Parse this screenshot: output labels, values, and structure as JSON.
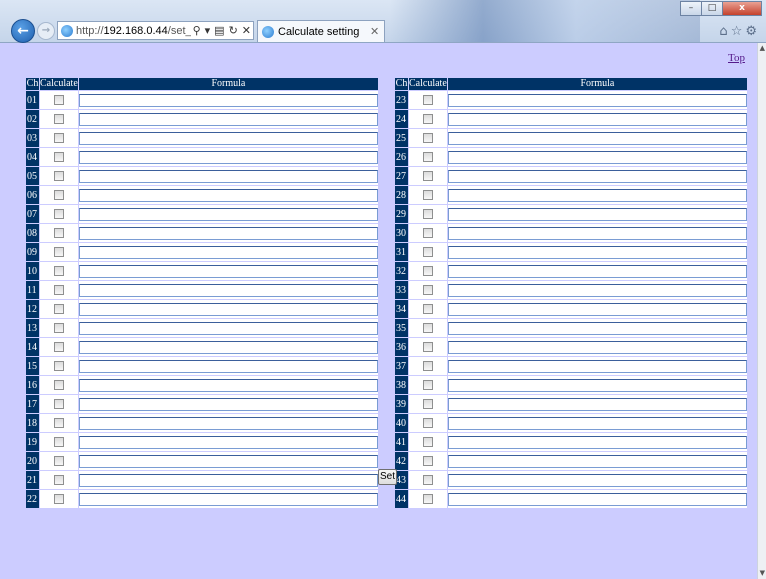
{
  "browser": {
    "url_prefix": "http://",
    "url_host": "192.168.0.44",
    "url_path": "/set_compute",
    "tab_title": "Calculate setting",
    "win_min": "–",
    "win_max": "□",
    "win_close": "x"
  },
  "page": {
    "top_link": "Top",
    "set_button": "Set",
    "headers": {
      "ch": "Ch",
      "calculate": "Calculate",
      "formula": "Formula"
    },
    "left_channels": [
      "01",
      "02",
      "03",
      "04",
      "05",
      "06",
      "07",
      "08",
      "09",
      "10",
      "11",
      "12",
      "13",
      "14",
      "15",
      "16",
      "17",
      "18",
      "19",
      "20",
      "21",
      "22"
    ],
    "right_channels": [
      "23",
      "24",
      "25",
      "26",
      "27",
      "28",
      "29",
      "30",
      "31",
      "32",
      "33",
      "34",
      "35",
      "36",
      "37",
      "38",
      "39",
      "40",
      "41",
      "42",
      "43",
      "44"
    ],
    "accent_color": "#003366",
    "background_color": "#ccccff"
  }
}
